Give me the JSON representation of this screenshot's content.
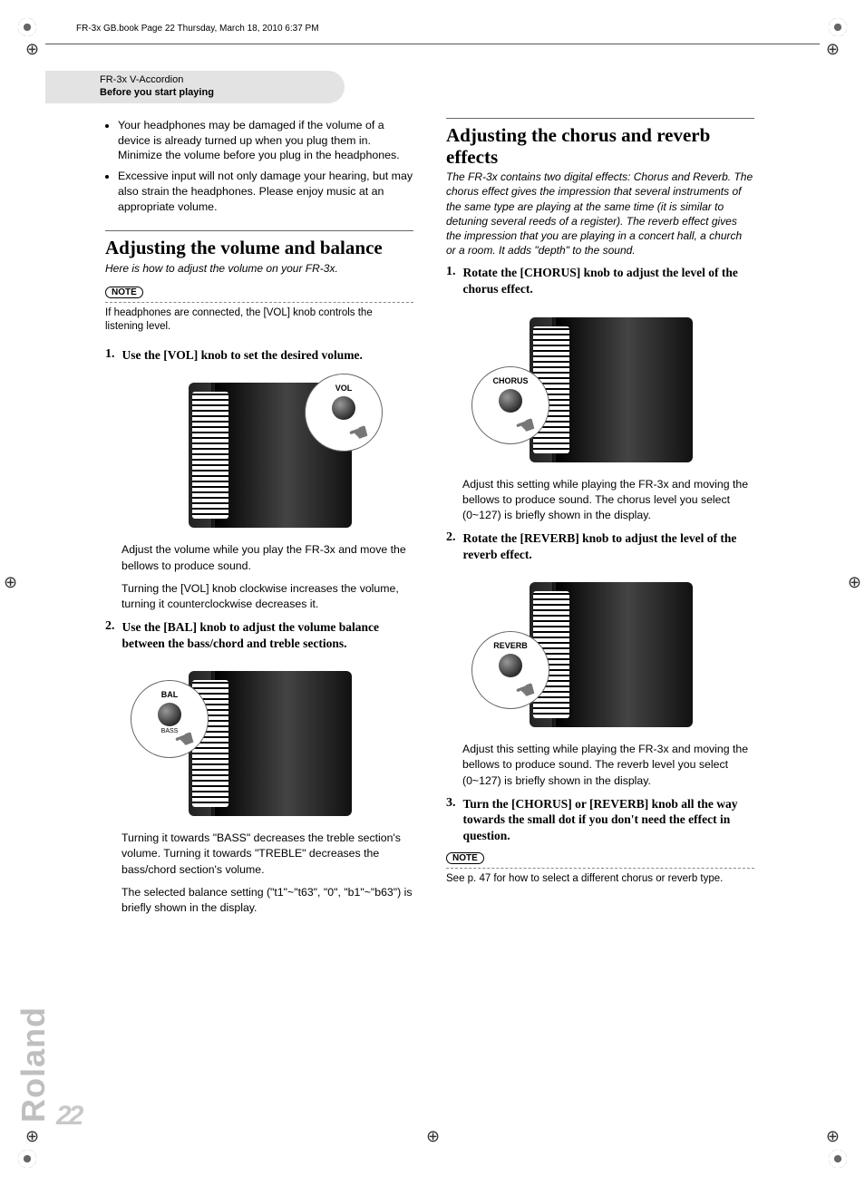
{
  "crop_caption": "FR-3x GB.book  Page 22  Thursday, March 18, 2010  6:37 PM",
  "header": {
    "product": "FR-3x V-Accordion",
    "section": "Before you start playing"
  },
  "brand": "Roland",
  "page_number": "22",
  "warnings": [
    "Your headphones may be damaged if the volume of a device is already turned up when you plug them in. Minimize the volume before you plug in the headphones.",
    "Excessive input will not only damage your hearing, but may also strain the headphones. Please enjoy music at an appropriate volume."
  ],
  "note_label": "NOTE",
  "sec1": {
    "title": "Adjusting the volume and balance",
    "intro": "Here is how to adjust the volume on your FR-3x.",
    "note": "If headphones are connected, the [VOL] knob controls the listening level.",
    "steps": [
      {
        "num": "1.",
        "head": "Use the [VOL] knob to set the desired volume.",
        "callout": "VOL",
        "body1": "Adjust the volume while you play the FR-3x and move the bellows to produce sound.",
        "body2": "Turning the [VOL] knob clockwise increases the volume, turning it counterclockwise decreases it."
      },
      {
        "num": "2.",
        "head": "Use the [BAL] knob to adjust the volume balance between the bass/chord and treble sections.",
        "callout": "BAL",
        "callout_sub": "BASS",
        "body1": "Turning it towards \"BASS\" decreases the treble section's volume. Turning it towards \"TREBLE\" decreases the bass/chord section's volume.",
        "body2": "The selected balance setting (\"t1\"~\"t63\", \"0\", \"b1\"~\"b63\") is briefly shown in the display."
      }
    ]
  },
  "sec2": {
    "title": "Adjusting the chorus and reverb effects",
    "intro": "The FR-3x contains two digital effects: Chorus and Reverb. The chorus effect gives the impression that several instruments of the same type are playing at the same time (it is similar to detuning several reeds of a register). The reverb effect gives the impression that you are playing in a concert hall, a church or a room. It adds \"depth\" to the sound.",
    "steps": [
      {
        "num": "1.",
        "head": "Rotate the [CHORUS] knob to adjust the level of the chorus effect.",
        "callout": "CHORUS",
        "body1": "Adjust this setting while playing the FR-3x and moving the bellows to produce sound. The chorus level you select (0~127) is briefly shown in the display."
      },
      {
        "num": "2.",
        "head": "Rotate the [REVERB] knob to adjust the level of the reverb effect.",
        "callout": "REVERB",
        "body1": "Adjust this setting while playing the FR-3x and moving the bellows to produce sound. The reverb level you select (0~127) is briefly shown in the display."
      },
      {
        "num": "3.",
        "head": "Turn the [CHORUS] or [REVERB] knob all the way towards the small dot if you don't need the effect in question."
      }
    ],
    "note": "See p. 47 for how to select a different chorus or reverb type."
  }
}
